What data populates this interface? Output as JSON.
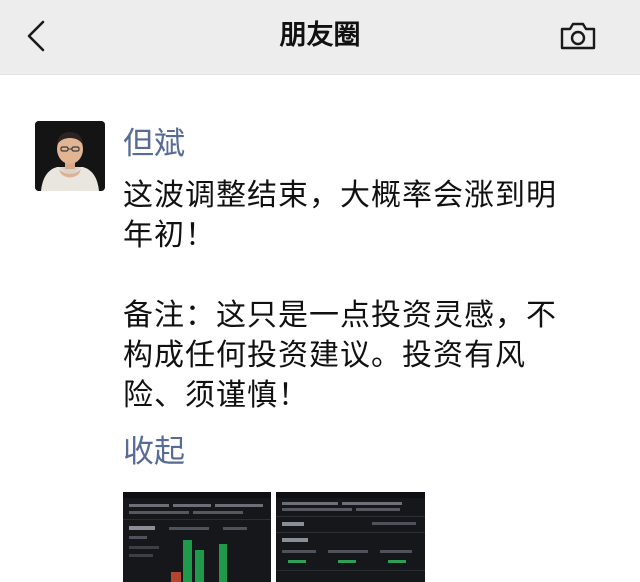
{
  "nav": {
    "title": "朋友圈",
    "back_icon": "chevron-left-icon",
    "camera_icon": "camera-icon"
  },
  "post": {
    "author": "但斌",
    "text": "这波调整结束，大概率会涨到明\n年初！\n\n备注：这只是一点投资灵感，不\n构成任何投资建议。投资有风\n险、须谨慎！",
    "collapse_label": "收起",
    "images": [
      "screenshot-thumbnail-1",
      "screenshot-thumbnail-2"
    ]
  },
  "colors": {
    "nav_bg": "#ededed",
    "link": "#576b95",
    "text": "#111111"
  }
}
